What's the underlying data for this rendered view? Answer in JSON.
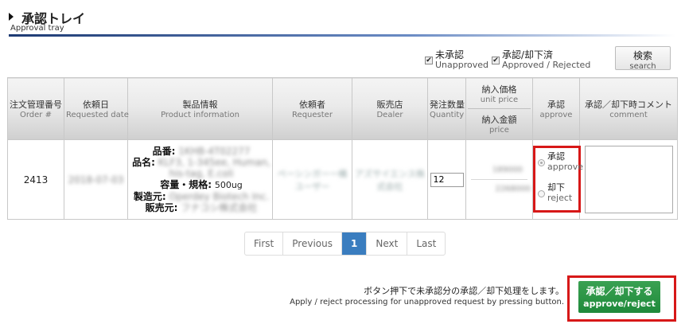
{
  "header": {
    "title": "承認トレイ",
    "subtitle": "Approval tray"
  },
  "filters": {
    "unapproved": {
      "label": "未承認",
      "sublabel": "Unapproved",
      "checked": true
    },
    "approved_rejected": {
      "label": "承認/却下済",
      "sublabel": "Approved / Rejected",
      "checked": true
    }
  },
  "search_button": {
    "label": "検索",
    "sublabel": "search"
  },
  "table": {
    "columns": [
      {
        "jp": "注文管理番号",
        "en": "Order #"
      },
      {
        "jp": "依頼日",
        "en": "Requested date"
      },
      {
        "jp": "製品情報",
        "en": "Product information"
      },
      {
        "jp": "依頼者",
        "en": "Requester"
      },
      {
        "jp": "販売店",
        "en": "Dealer"
      },
      {
        "jp": "発注数量",
        "en": "Quantity"
      },
      {
        "jp": "納入価格",
        "en": "unit price",
        "jp2": "納入金額",
        "en2": "price"
      },
      {
        "jp": "承認",
        "en": "approve"
      },
      {
        "jp": "承認／却下時コメント",
        "en": "comment"
      }
    ],
    "rows": [
      {
        "order_no": "2413",
        "requested_date": "2018-07-03",
        "product": {
          "item_no_label": "品番:",
          "item_no": "1KHB-4T02277",
          "name_label": "品名:",
          "name_line1": "KLF3, 1-345ee, Human,",
          "name_line2": "his-tag, E.coli",
          "size_label": "容量・規格:",
          "size": "500ug",
          "maker_label": "製造元:",
          "maker": "Operdey Biotech Inc.",
          "seller_label": "販売元:",
          "seller": "フナコシ株式会社"
        },
        "requester_line1": "ペーシンガー一桶",
        "requester_line2": "ユーザー",
        "dealer_line1": "アズサイエンス株",
        "dealer_line2": "式会社",
        "quantity": "12",
        "unit_price": "189000",
        "total_price": "2268000",
        "approve_option": {
          "label": "承認",
          "sublabel": "approve",
          "selected": true
        },
        "reject_option": {
          "label": "却下",
          "sublabel": "reject",
          "selected": false
        },
        "comment": ""
      }
    ]
  },
  "pagination": {
    "first": "First",
    "previous": "Previous",
    "current": "1",
    "next": "Next",
    "last": "Last"
  },
  "footer": {
    "note_jp": "ボタン押下で未承認分の承認／却下処理をします。",
    "note_en": "Apply / reject processing for unapproved request by pressing button.",
    "submit_label": "承認／却下する",
    "submit_sublabel": "approve/reject"
  },
  "colors": {
    "accent_blue": "#3a7dbf",
    "submit_green": "#2a9647",
    "highlight_red": "#d71818",
    "title_rule": "#1d3a73"
  }
}
